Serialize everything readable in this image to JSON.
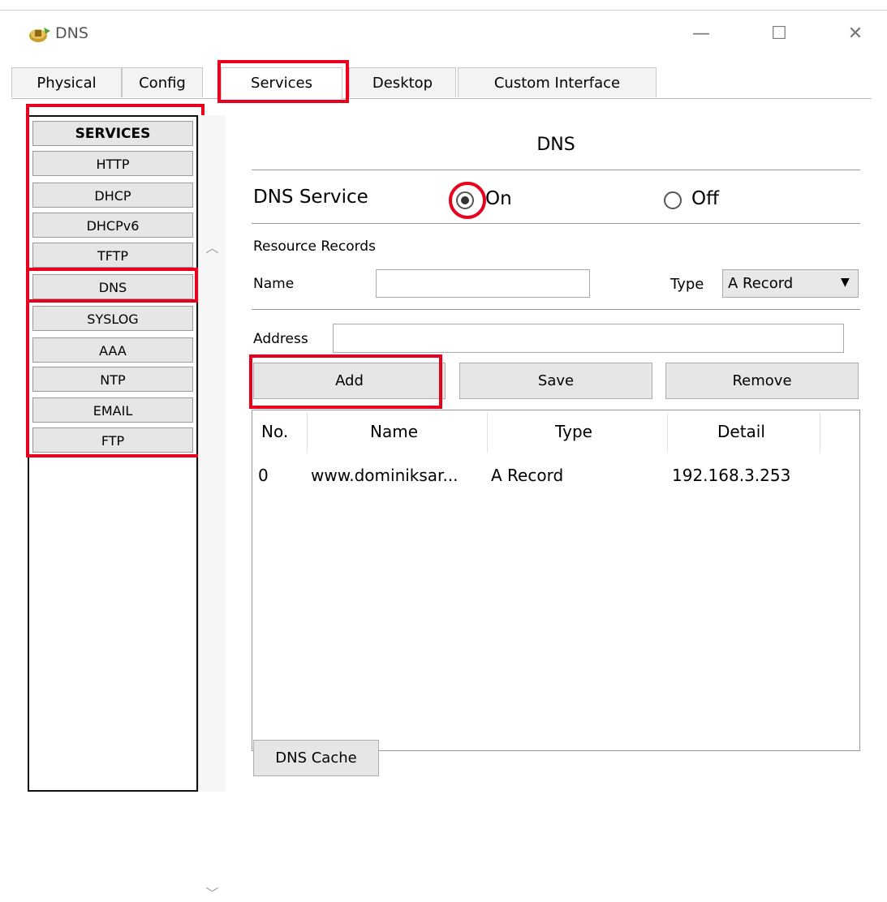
{
  "window": {
    "title": "DNS",
    "controls": {
      "minimize": "—",
      "maximize": "☐",
      "close": "✕"
    }
  },
  "tabs": [
    "Physical",
    "Config",
    "Services",
    "Desktop",
    "Custom Interface"
  ],
  "active_tab": "Services",
  "services": {
    "header": "SERVICES",
    "items": [
      "HTTP",
      "DHCP",
      "DHCPv6",
      "TFTP",
      "DNS",
      "SYSLOG",
      "AAA",
      "NTP",
      "EMAIL",
      "FTP"
    ],
    "selected": "DNS"
  },
  "dns": {
    "heading": "DNS",
    "service_label": "DNS Service",
    "on_label": "On",
    "off_label": "Off",
    "service_state": "On",
    "resource_records_label": "Resource Records",
    "name_label": "Name",
    "name_value": "",
    "type_label": "Type",
    "type_value": "A Record",
    "address_label": "Address",
    "address_value": "",
    "buttons": {
      "add": "Add",
      "save": "Save",
      "remove": "Remove"
    },
    "table": {
      "columns": [
        "No.",
        "Name",
        "Type",
        "Detail"
      ],
      "rows": [
        {
          "no": "0",
          "name": "www.dominiksar...",
          "type": "A Record",
          "detail": "192.168.3.253"
        }
      ]
    },
    "cache_button": "DNS Cache"
  },
  "colors": {
    "highlight": "#e8001c",
    "button_bg": "#e6e6e6"
  }
}
